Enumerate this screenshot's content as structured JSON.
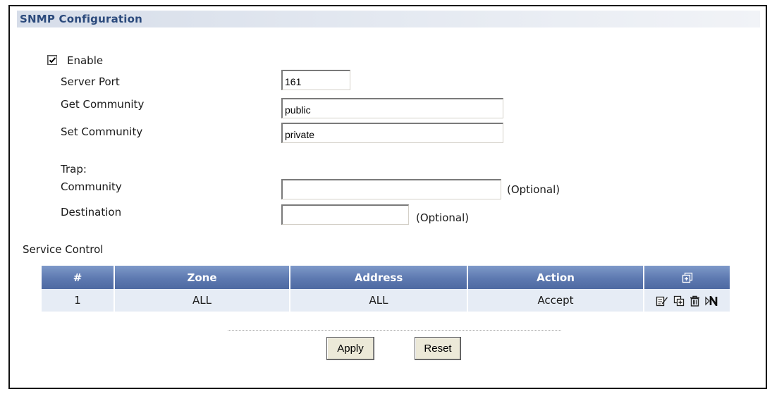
{
  "section": {
    "title": "SNMP Configuration"
  },
  "enable": {
    "label": "Enable",
    "checked": true
  },
  "fields": {
    "server_port": {
      "label": "Server Port",
      "value": "161"
    },
    "get_community": {
      "label": "Get Community",
      "value": "public"
    },
    "set_community": {
      "label": "Set Community",
      "value": "private"
    }
  },
  "trap": {
    "heading": "Trap:",
    "community": {
      "label": "Community",
      "value": "",
      "note": "(Optional)"
    },
    "destination": {
      "label": "Destination",
      "value": "",
      "note": "(Optional)"
    }
  },
  "service_control": {
    "label": "Service Control",
    "columns": [
      "#",
      "Zone",
      "Address",
      "Action"
    ],
    "header_icon": "add-icon",
    "rows": [
      {
        "num": "1",
        "zone": "ALL",
        "address": "ALL",
        "action": "Accept",
        "icons": [
          "edit-icon",
          "insert-icon",
          "delete-icon",
          "move-icon"
        ]
      }
    ]
  },
  "buttons": {
    "apply": "Apply",
    "reset": "Reset"
  },
  "colors": {
    "title": "#2b4a7c",
    "table_header": "#5d79b0",
    "table_row": "#e6ecf5"
  }
}
